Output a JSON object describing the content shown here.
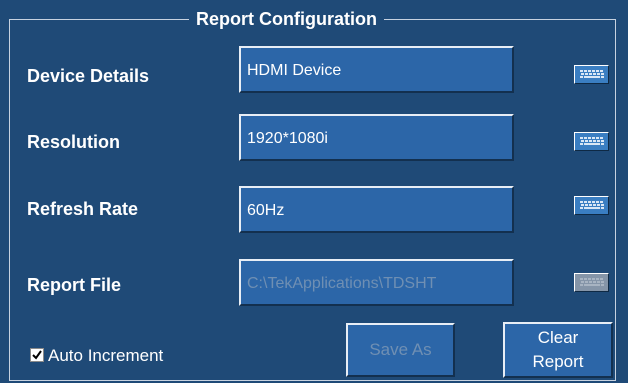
{
  "panel": {
    "title": "Report Configuration"
  },
  "rows": [
    {
      "label": "Device Details",
      "value": "HDMI Device",
      "enabled": true,
      "icon": "keyboard-icon"
    },
    {
      "label": "Resolution",
      "value": "1920*1080i",
      "enabled": true,
      "icon": "keyboard-icon"
    },
    {
      "label": "Refresh Rate",
      "value": "60Hz",
      "enabled": true,
      "icon": "keyboard-icon"
    },
    {
      "label": "Report File",
      "value": "C:\\TekApplications\\TDSHT",
      "enabled": false,
      "icon": "keyboard-icon"
    }
  ],
  "auto_increment": {
    "label": "Auto Increment",
    "checked": true
  },
  "buttons": {
    "save_as": {
      "label": "Save As",
      "enabled": false
    },
    "clear_report": {
      "line1": "Clear",
      "line2": "Report",
      "enabled": true
    }
  },
  "colors": {
    "background": "#1f4a77",
    "field": "#2c66a8",
    "text": "#ffffff",
    "disabled_text": "#6f8fb3"
  }
}
